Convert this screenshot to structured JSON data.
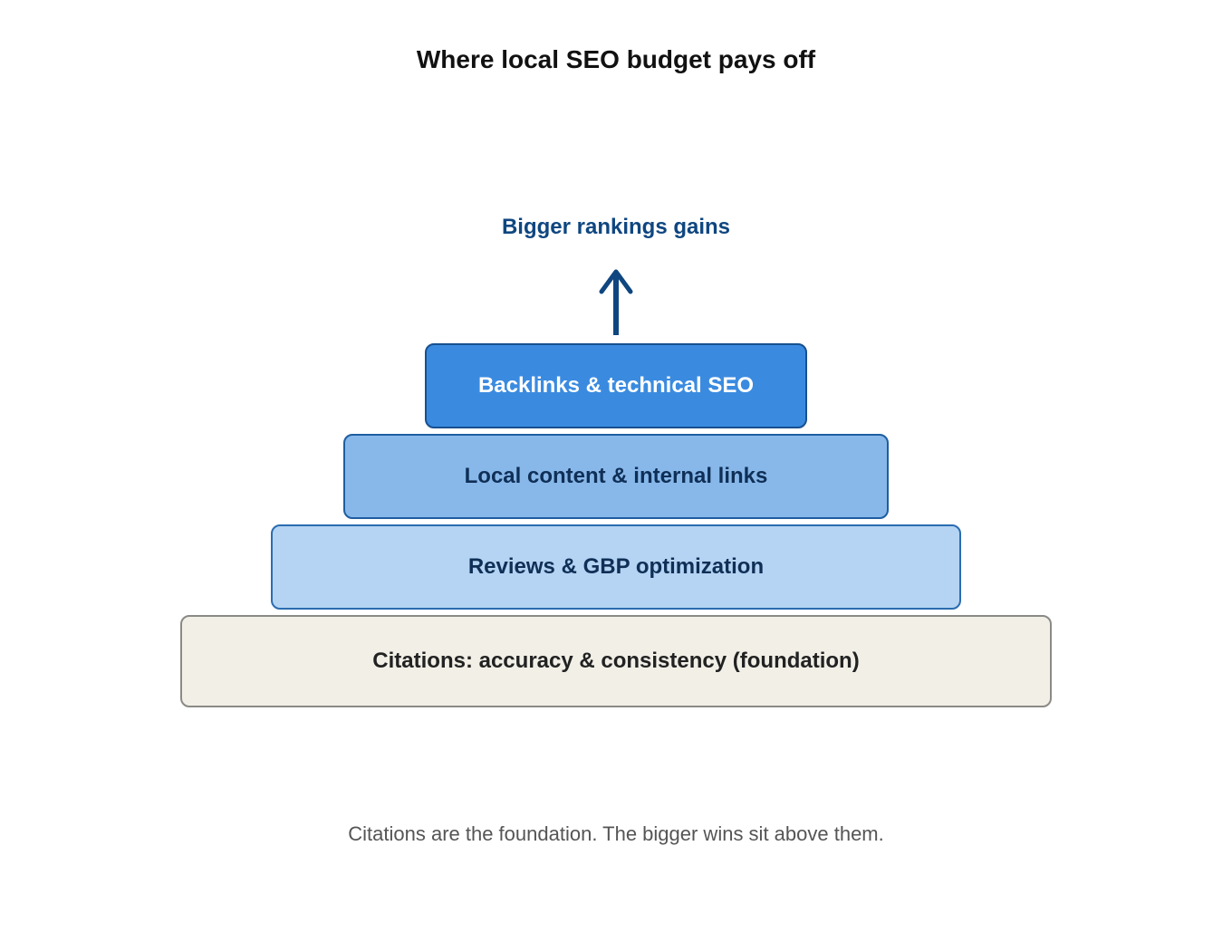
{
  "title": "Where local SEO budget pays off",
  "gain_label": "Bigger rankings gains",
  "arrow_icon": "arrow-up-icon",
  "tiers": [
    {
      "label": "Backlinks & technical SEO",
      "fill": "#3a8be0",
      "border": "#17508f",
      "text_color": "#ffffff"
    },
    {
      "label": "Local content & internal links",
      "fill": "#88b8ea",
      "border": "#1e5ea0",
      "text_color": "#0f2f56"
    },
    {
      "label": "Reviews & GBP optimization",
      "fill": "#b5d4f3",
      "border": "#2b6cb0",
      "text_color": "#0f2f56"
    },
    {
      "label": "Citations: accuracy & consistency (foundation)",
      "fill": "#f2efe7",
      "border": "#8a8a86",
      "text_color": "#222222"
    }
  ],
  "caption": "Citations are the foundation. The bigger wins sit above them.",
  "colors": {
    "accent": "#0f4680",
    "caption": "#555555"
  }
}
